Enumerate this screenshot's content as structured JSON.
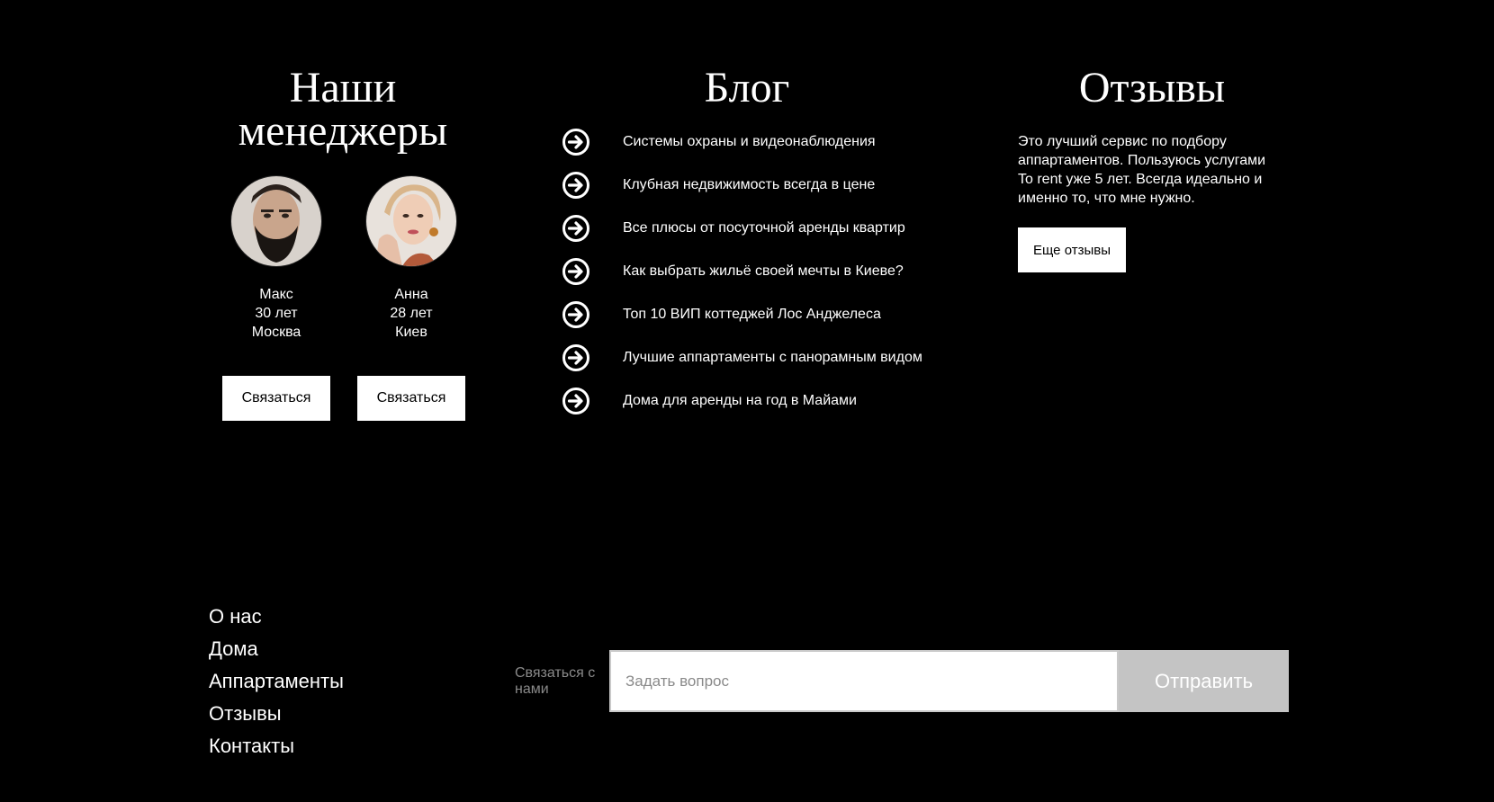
{
  "managers": {
    "title": "Наши менеджеры",
    "people": [
      {
        "name": "Макс",
        "age": "30 лет",
        "city": "Москва",
        "button_label": "Связаться"
      },
      {
        "name": "Анна",
        "age": "28 лет",
        "city": "Киев",
        "button_label": "Связаться"
      }
    ]
  },
  "blog": {
    "title": "Блог",
    "icon": "arrow-circle-right-icon",
    "items": [
      "Системы охраны и видеонаблюдения",
      "Клубная недвижимость всегда в цене",
      "Все плюсы от посуточной аренды квартир",
      "Как выбрать жильё своей мечты в Киеве?",
      "Топ 10 ВИП коттеджей Лос Анджелеса",
      "Лучшие аппартаменты с панорамным видом",
      "Дома для аренды на год в Майами"
    ]
  },
  "reviews": {
    "title": "Отзывы",
    "text": "Это лучший сервис по подбору аппартаментов. Пользуюсь услугами To rent уже 5 лет. Всегда идеально и именно то, что мне нужно.",
    "button_label": "Еще отзывы"
  },
  "footer": {
    "nav": [
      "О нас",
      "Дома",
      "Аппартаменты",
      "Отзывы",
      "Контакты"
    ],
    "contact_label": "Связаться с нами",
    "question_placeholder": "Задать вопрос",
    "question_value": "",
    "send_label": "Отправить"
  },
  "colors": {
    "background": "#000000",
    "text": "#ffffff",
    "button_bg": "#ffffff",
    "send_button_bg": "#c4c4c4",
    "muted_text": "#8a8a8a"
  }
}
